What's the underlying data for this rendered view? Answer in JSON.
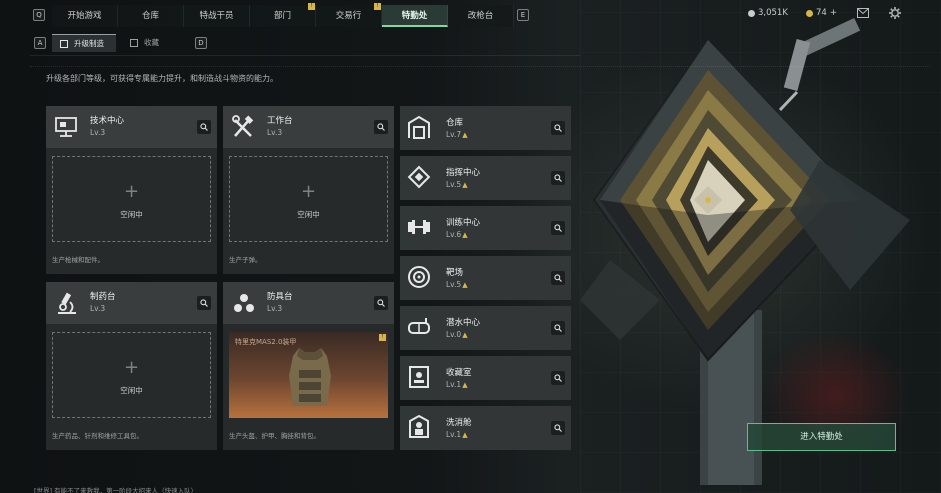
{
  "nav": {
    "left_key": "Q",
    "right_key": "E",
    "tabs": [
      {
        "label": "开始游戏",
        "active": false,
        "badge": ""
      },
      {
        "label": "仓库",
        "active": false,
        "badge": ""
      },
      {
        "label": "特战干员",
        "active": false,
        "badge": ""
      },
      {
        "label": "部门",
        "active": false,
        "badge": "!"
      },
      {
        "label": "交易行",
        "active": false,
        "badge": "!"
      },
      {
        "label": "特勤处",
        "active": true,
        "badge": ""
      },
      {
        "label": "改枪台",
        "active": false,
        "badge": ""
      }
    ]
  },
  "currency": {
    "coins": "3,051K",
    "gems": "74",
    "add": "+"
  },
  "icons": {
    "mail": "mail-icon",
    "settings": "gear-icon"
  },
  "subtabs": {
    "left_key": "A",
    "right_key": "D",
    "items": [
      {
        "label": "升级制造",
        "active": true
      },
      {
        "label": "收藏",
        "active": false
      }
    ]
  },
  "description": "升级各部门等级，可获得专属能力提升，和制造战斗物资的能力。",
  "workstations": [
    {
      "name": "技术中心",
      "level": "Lv.3",
      "slot_status": "空闲中",
      "footer": "生产枪械和配件。",
      "icon": "monitor-icon"
    },
    {
      "name": "工作台",
      "level": "Lv.3",
      "slot_status": "空闲中",
      "footer": "生产子弹。",
      "icon": "tools-icon"
    },
    {
      "name": "制药台",
      "level": "Lv.3",
      "slot_status": "空闲中",
      "footer": "生产药品、针剂和维修工具包。",
      "icon": "microscope-icon"
    },
    {
      "name": "防具台",
      "level": "Lv.3",
      "product": "特里克MAS2.0装甲",
      "product_badge": "!",
      "footer": "生产头盔、护甲、胸挂和背包。",
      "icon": "armor-parts-icon"
    }
  ],
  "departments": [
    {
      "name": "仓库",
      "level": "Lv.7",
      "icon": "warehouse-icon"
    },
    {
      "name": "指挥中心",
      "level": "Lv.5",
      "icon": "command-icon"
    },
    {
      "name": "训练中心",
      "level": "Lv.6",
      "icon": "dumbbell-icon"
    },
    {
      "name": "靶场",
      "level": "Lv.5",
      "icon": "target-icon"
    },
    {
      "name": "潜水中心",
      "level": "Lv.0",
      "icon": "diving-mask-icon"
    },
    {
      "name": "收藏室",
      "level": "Lv.1",
      "icon": "collection-icon"
    },
    {
      "name": "洗消舱",
      "level": "Lv.1",
      "icon": "shower-icon"
    }
  ],
  "enter_button": "进入特勤处",
  "chat_line": "[世界] 有能不了来救我，第一阶段大招来人（快速入队）"
}
